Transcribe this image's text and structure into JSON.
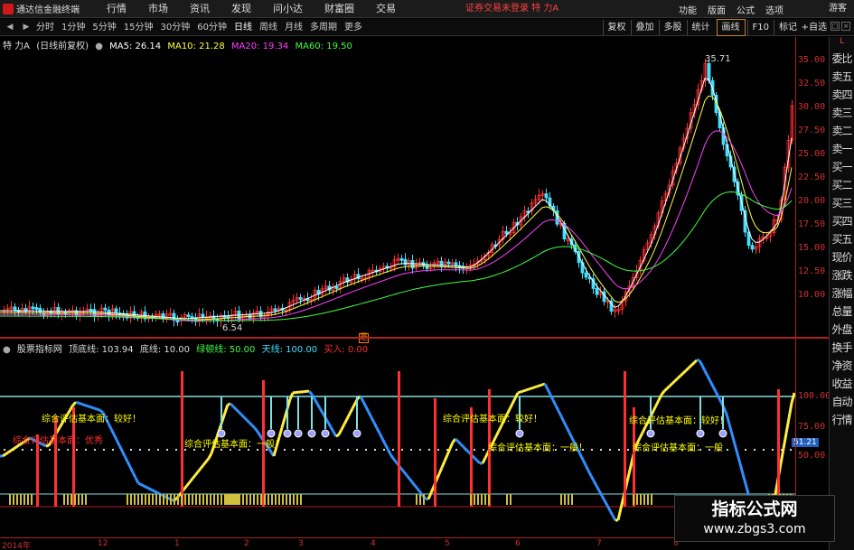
{
  "top_menu": {
    "app_title": "通达信金融终端",
    "items": [
      "行情",
      "市场",
      "资讯",
      "发现",
      "问小达",
      "财富圈",
      "交易"
    ],
    "login_status": "证券交易未登录  特 力A",
    "right_items": [
      "功能",
      "版面",
      "公式",
      "选项"
    ],
    "guest": "游客"
  },
  "period_bar": {
    "periods": [
      "分时",
      "1分钟",
      "5分钟",
      "15分钟",
      "30分钟",
      "60分钟",
      "日线",
      "周线",
      "月线",
      "多周期",
      "更多"
    ],
    "active": "日线",
    "tools": [
      "复权",
      "叠加",
      "多股",
      "统计",
      "画线",
      "F10",
      "标记"
    ],
    "self_select": "+自选"
  },
  "main_chart": {
    "stock_name": "特 力A",
    "adjust_mode": "(日线前复权)",
    "ma5": "MA5: 26.14",
    "ma10": "MA10: 21.28",
    "ma20": "MA20: 19.34",
    "ma60": "MA60: 19.50",
    "high_label": "35.71",
    "low_label": "6.54",
    "marker": "是",
    "y_ticks": [
      "35.00",
      "32.50",
      "30.00",
      "27.50",
      "25.00",
      "22.50",
      "20.00",
      "17.50",
      "15.00",
      "12.50",
      "10.00"
    ],
    "colors": {
      "up": "#ff3030",
      "down": "#40e0ff",
      "ma5": "#ffffff",
      "ma10": "#ffff40",
      "ma20": "#ff40ff",
      "ma60": "#40ff40"
    }
  },
  "indicator": {
    "name": "股票指标网",
    "top_line": "顶底线: 103.94",
    "bottom_line": "底线: 10.00",
    "green_line": "绿顿线: 50.00",
    "sky_line": "天线: 100.00",
    "buy": "买入: 0.00",
    "y_ticks": [
      "100.00",
      "75.00",
      "50.00"
    ],
    "value_box": "51.21",
    "text_labels": [
      "综合评估基本面：较好！",
      "综合评估基本面：优秀",
      "综合评估基本面：一般！",
      "综合评估基本面：较好！",
      "综合评估基本面：一般！",
      "综合评估基本面：较好！",
      "综合评估基本面：一般"
    ]
  },
  "x_axis": {
    "labels": [
      "2014年",
      "12",
      "1",
      "2",
      "3",
      "4",
      "5",
      "6",
      "7",
      "8"
    ]
  },
  "side_panel": {
    "top": "L",
    "items": [
      "委比",
      "卖五",
      "卖四",
      "卖三",
      "卖二",
      "卖一",
      "买一",
      "买二",
      "买三",
      "买四",
      "买五",
      "现价",
      "涨跌",
      "涨幅",
      "总量",
      "外盘",
      "换手",
      "净资",
      "收益",
      "自动",
      "行情"
    ]
  },
  "watermark": {
    "title": "指标公式网",
    "url": "www.zbgs3.com"
  }
}
